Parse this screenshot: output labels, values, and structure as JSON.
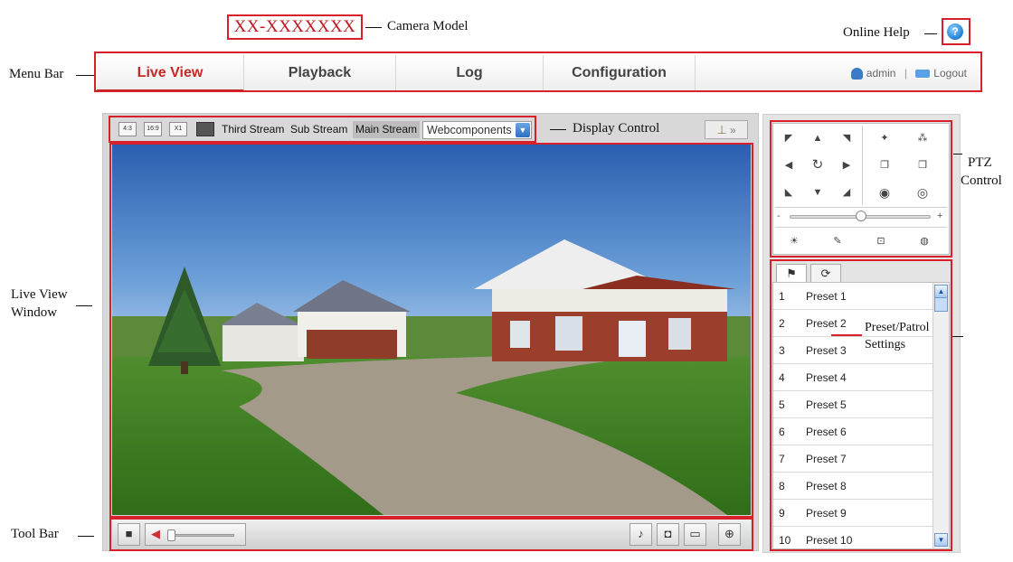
{
  "header": {
    "camera_model": "XX-XXXXXXX",
    "help_icon": "?"
  },
  "callouts": {
    "camera_model": "Camera Model",
    "online_help": "Online Help",
    "menu_bar": "Menu Bar",
    "display_control": "Display Control",
    "ptz_control_1": "PTZ",
    "ptz_control_2": "Control",
    "live_view_window_1": "Live View",
    "live_view_window_2": "Window",
    "preset_patrol_1": "Preset/Patrol",
    "preset_patrol_2": "Settings",
    "tool_bar": "Tool Bar"
  },
  "menu": {
    "items": [
      "Live View",
      "Playback",
      "Log",
      "Configuration"
    ],
    "user": "admin",
    "separator": "|",
    "logout": "Logout"
  },
  "display_control": {
    "aspect_buttons": [
      "4:3",
      "16:9",
      "X1"
    ],
    "streams": [
      "Third Stream",
      "Sub Stream",
      "Main Stream"
    ],
    "selected_stream": "Main Stream",
    "plugin": "Webcomponents",
    "extra_label": "»"
  },
  "presets": {
    "tab_icons": [
      "preset-flag-icon",
      "patrol-loop-icon"
    ],
    "items": [
      {
        "num": "1",
        "name": "Preset 1"
      },
      {
        "num": "2",
        "name": "Preset 2"
      },
      {
        "num": "3",
        "name": "Preset 3"
      },
      {
        "num": "4",
        "name": "Preset 4"
      },
      {
        "num": "5",
        "name": "Preset 5"
      },
      {
        "num": "6",
        "name": "Preset 6"
      },
      {
        "num": "7",
        "name": "Preset 7"
      },
      {
        "num": "8",
        "name": "Preset 8"
      },
      {
        "num": "9",
        "name": "Preset 9"
      },
      {
        "num": "10",
        "name": "Preset 10"
      }
    ]
  },
  "ptz": {
    "speed_minus": "-",
    "speed_plus": "+"
  },
  "colors": {
    "annotation_red": "#d8202a",
    "active_menu": "#c62828"
  }
}
